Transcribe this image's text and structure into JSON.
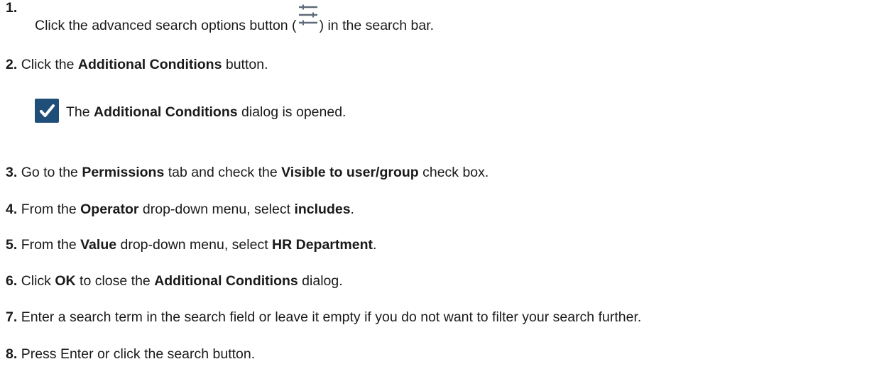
{
  "steps": [
    {
      "num": "1.",
      "t1": "Click the advanced search options button (",
      "t2": ") in the search bar."
    },
    {
      "num": "2.",
      "t1": "Click the ",
      "b1": "Additional Conditions",
      "t2": " button."
    },
    {
      "num": "3.",
      "t1": "Go to the ",
      "b1": "Permissions",
      "t2": " tab and check the ",
      "b2": "Visible to user/group",
      "t3": " check box."
    },
    {
      "num": "4.",
      "t1": "From the ",
      "b1": "Operator",
      "t2": " drop-down menu, select ",
      "b2": "includes",
      "t3": "."
    },
    {
      "num": "5.",
      "t1": "From the ",
      "b1": "Value",
      "t2": " drop-down menu, select ",
      "b2": "HR Department",
      "t3": "."
    },
    {
      "num": "6.",
      "t1": "Click ",
      "b1": "OK",
      "t2": " to close the ",
      "b2": "Additional Conditions",
      "t3": " dialog."
    },
    {
      "num": "7.",
      "t1": "Enter a search term in the search field or leave it empty if you do not want to filter your search further."
    },
    {
      "num": "8.",
      "t1": "Press Enter or click the search button."
    }
  ],
  "result": {
    "t1": "The ",
    "b1": "Additional Conditions",
    "t2": " dialog is opened."
  },
  "icons": {
    "advanced_search": "sliders-icon",
    "result": "checkmark-icon"
  },
  "colors": {
    "icon": "#5f6b7a",
    "check_bg": "#1f4e79"
  }
}
